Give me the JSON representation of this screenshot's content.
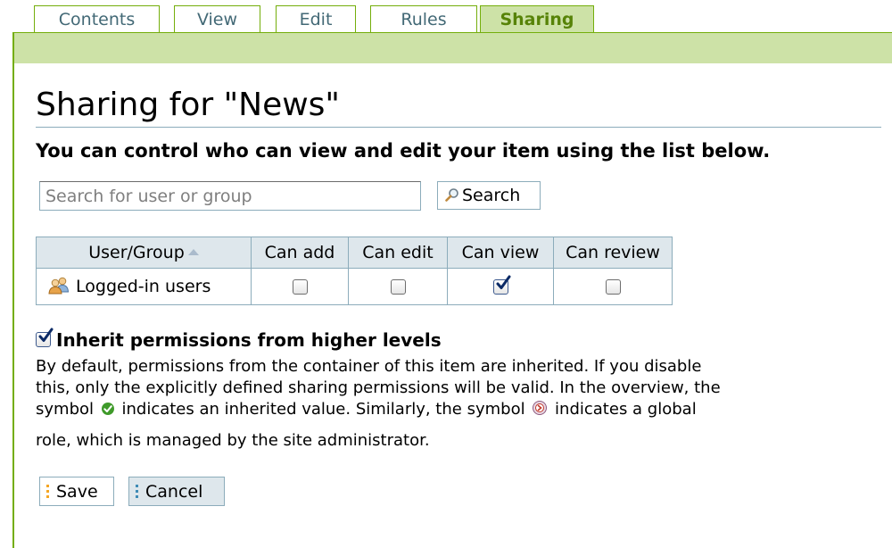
{
  "tabs": [
    {
      "label": "Contents",
      "selected": false
    },
    {
      "label": "View",
      "selected": false
    },
    {
      "label": "Edit",
      "selected": false
    },
    {
      "label": "Rules",
      "selected": false
    },
    {
      "label": "Sharing",
      "selected": true
    }
  ],
  "page": {
    "title": "Sharing for \"News\"",
    "description": "You can control who can view and edit your item using the list below."
  },
  "search": {
    "placeholder": "Search for user or group",
    "value": "",
    "button_label": "Search",
    "button_icon": "magnifier-icon"
  },
  "table": {
    "columns": [
      "User/Group",
      "Can add",
      "Can edit",
      "Can view",
      "Can review"
    ],
    "sort_column": "User/Group",
    "sort_direction": "ascending",
    "rows": [
      {
        "name": "Logged-in users",
        "icon": "group-icon",
        "can_add": false,
        "can_edit": false,
        "can_view": true,
        "can_review": false
      }
    ]
  },
  "inherit": {
    "label": "Inherit permissions from higher levels",
    "checked": true,
    "help_line1": "By default, permissions from the container of this item are inherited. If you disable",
    "help_line2": "this, only the explicitly defined sharing permissions will be valid. In the overview, the",
    "help_line3a": "symbol",
    "help_line3b": "indicates an inherited value. Similarly, the symbol",
    "help_line3c": "indicates a global",
    "help_line4": "role, which is managed by the site administrator.",
    "inherited_icon": "green-check-icon",
    "global_role_icon": "global-role-icon"
  },
  "buttons": {
    "save_label": "Save",
    "cancel_label": "Cancel"
  },
  "colors": {
    "tab_border": "#74ae0b",
    "tab_selected_bg": "#cde2a7",
    "table_header_bg": "#dee7ec",
    "table_border": "#8cacbb"
  }
}
